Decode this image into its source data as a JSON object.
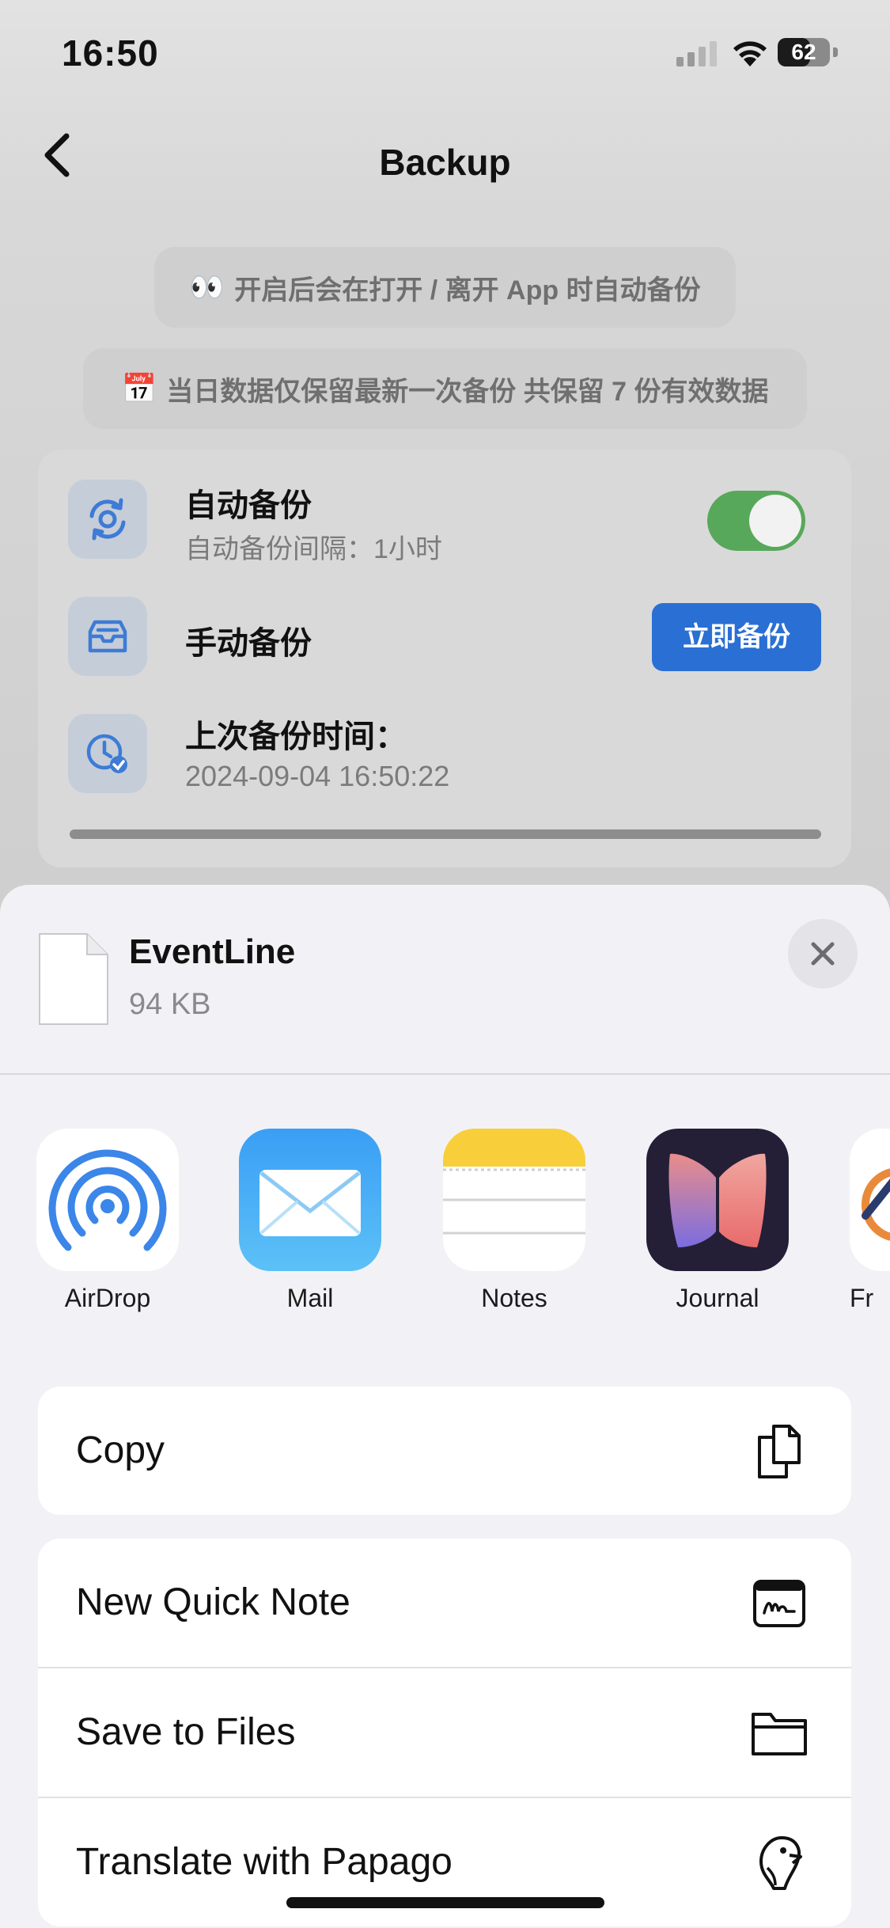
{
  "status_bar": {
    "time": "16:50",
    "battery": "62"
  },
  "nav": {
    "title": "Backup"
  },
  "tips": [
    {
      "emoji": "👀",
      "text": "开启后会在打开 / 离开 App 时自动备份"
    },
    {
      "emoji": "📅",
      "text": "当日数据仅保留最新一次备份 共保留 7 份有效数据"
    }
  ],
  "settings": {
    "auto_backup": {
      "title": "自动备份",
      "subtitle": "自动备份间隔：1小时",
      "enabled": true
    },
    "manual_backup": {
      "title": "手动备份",
      "button_label": "立即备份"
    },
    "last_backup": {
      "title": "上次备份时间：",
      "value": "2024-09-04 16:50:22"
    }
  },
  "share_sheet": {
    "file": {
      "name": "EventLine",
      "size": "94 KB",
      "icon": "document-icon"
    },
    "apps": [
      {
        "label": "AirDrop",
        "icon": "airdrop-icon"
      },
      {
        "label": "Mail",
        "icon": "mail-icon"
      },
      {
        "label": "Notes",
        "icon": "notes-icon"
      },
      {
        "label": "Journal",
        "icon": "journal-icon"
      },
      {
        "label": "Fr",
        "icon": "partial-app-icon"
      }
    ],
    "actions_group_1": [
      {
        "label": "Copy",
        "icon": "copy-icon"
      }
    ],
    "actions_group_2": [
      {
        "label": "New Quick Note",
        "icon": "quick-note-icon"
      },
      {
        "label": "Save to Files",
        "icon": "folder-icon"
      },
      {
        "label": "Translate with Papago",
        "icon": "papago-icon"
      }
    ]
  },
  "colors": {
    "accent_blue": "#2a6fd4",
    "toggle_green": "#58a85b"
  }
}
